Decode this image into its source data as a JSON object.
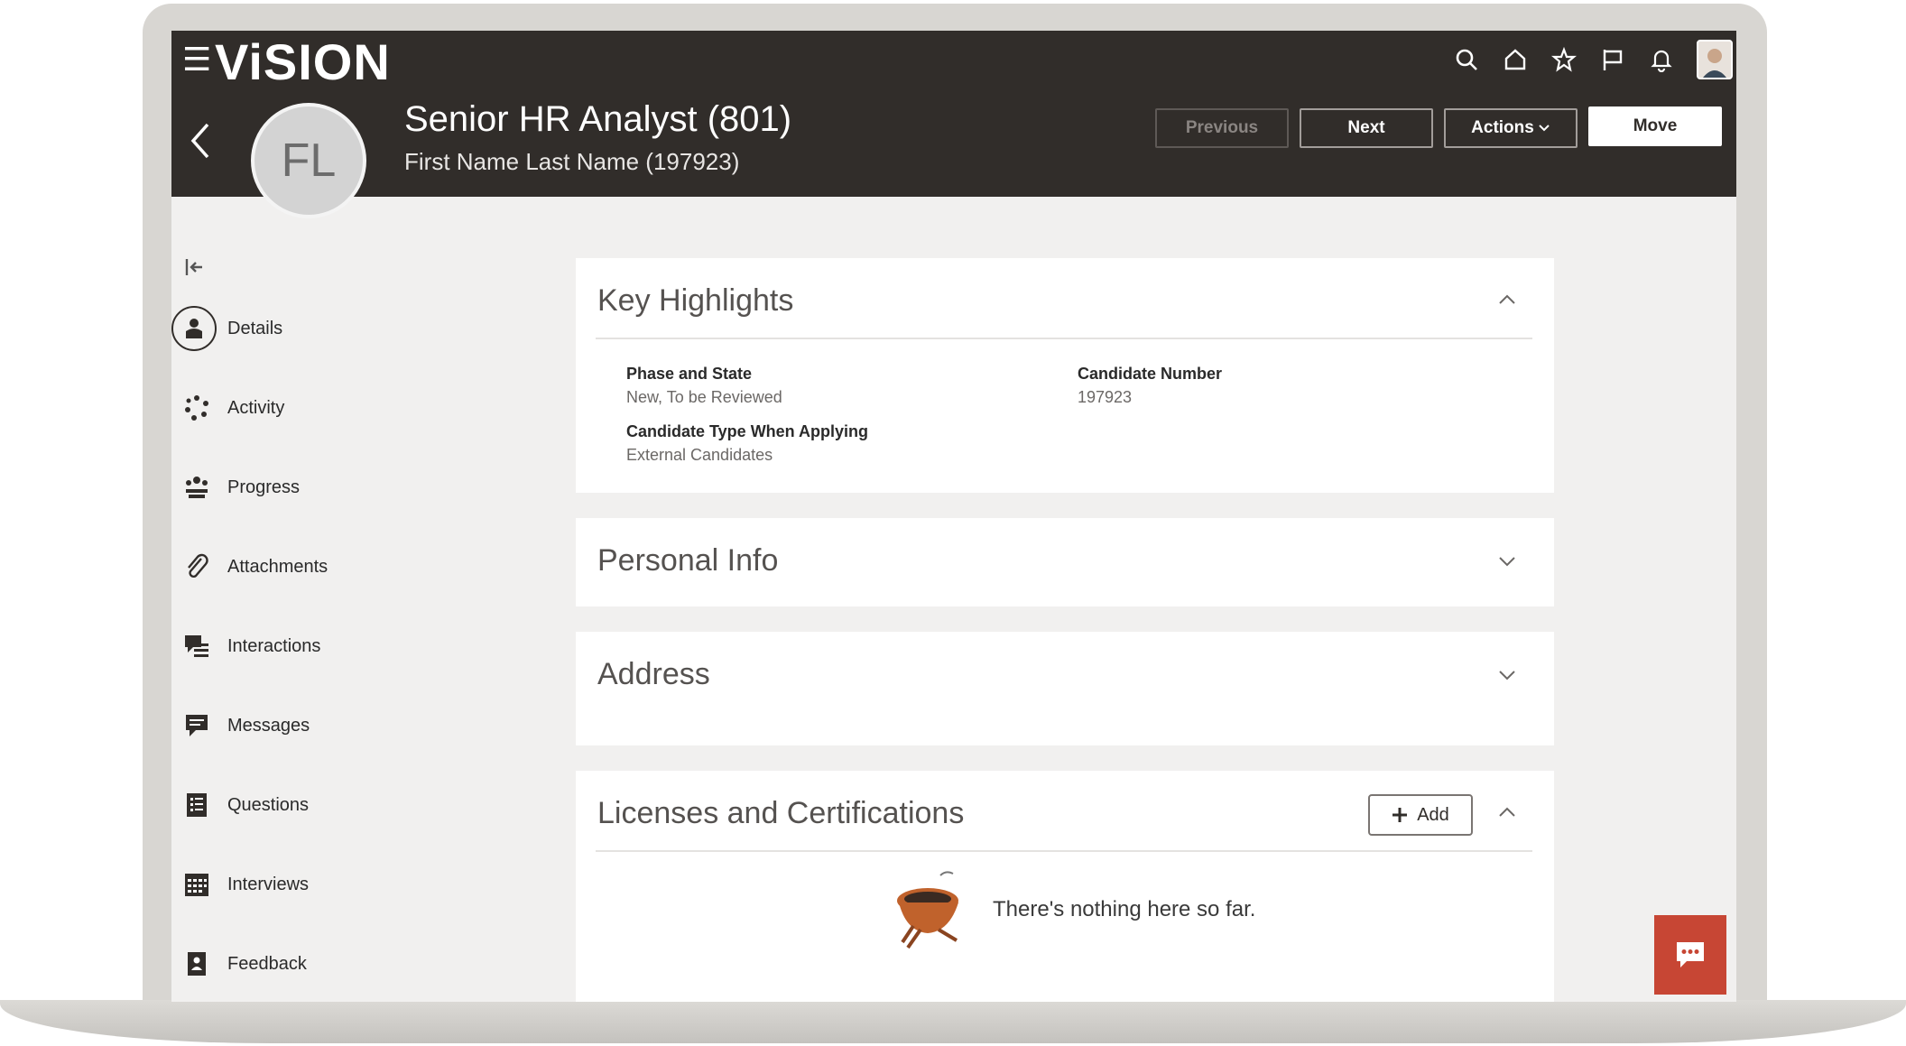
{
  "app": {
    "logo": "ViSION"
  },
  "header": {
    "title": "Senior HR Analyst (801)",
    "subtitle": "First Name Last Name (197923)",
    "avatar_initials": "FL",
    "buttons": {
      "previous": "Previous",
      "next": "Next",
      "actions": "Actions",
      "move": "Move"
    },
    "icons": [
      "search-icon",
      "home-icon",
      "star-icon",
      "flag-icon",
      "bell-icon",
      "user-avatar"
    ]
  },
  "sidebar": {
    "items": [
      {
        "label": "Details",
        "icon": "details-icon",
        "selected": true
      },
      {
        "label": "Activity",
        "icon": "activity-icon"
      },
      {
        "label": "Progress",
        "icon": "progress-icon"
      },
      {
        "label": "Attachments",
        "icon": "paperclip-icon"
      },
      {
        "label": "Interactions",
        "icon": "interactions-icon"
      },
      {
        "label": "Messages",
        "icon": "message-icon"
      },
      {
        "label": "Questions",
        "icon": "questions-icon"
      },
      {
        "label": "Interviews",
        "icon": "calendar-icon"
      },
      {
        "label": "Feedback",
        "icon": "feedback-icon"
      }
    ]
  },
  "sections": {
    "key_highlights": {
      "title": "Key Highlights",
      "fields": [
        {
          "label": "Phase and State",
          "value": "New, To be Reviewed"
        },
        {
          "label": "Candidate Number",
          "value": "197923"
        },
        {
          "label": "Candidate Type When Applying",
          "value": "External Candidates"
        }
      ]
    },
    "personal_info": {
      "title": "Personal Info"
    },
    "address": {
      "title": "Address"
    },
    "licenses": {
      "title": "Licenses and Certifications",
      "add_label": "Add",
      "empty_text": "There's nothing here so far."
    }
  },
  "colors": {
    "header_bg": "#312d2a",
    "chat_button": "#c74634",
    "page_bg": "#f1f0ef"
  }
}
